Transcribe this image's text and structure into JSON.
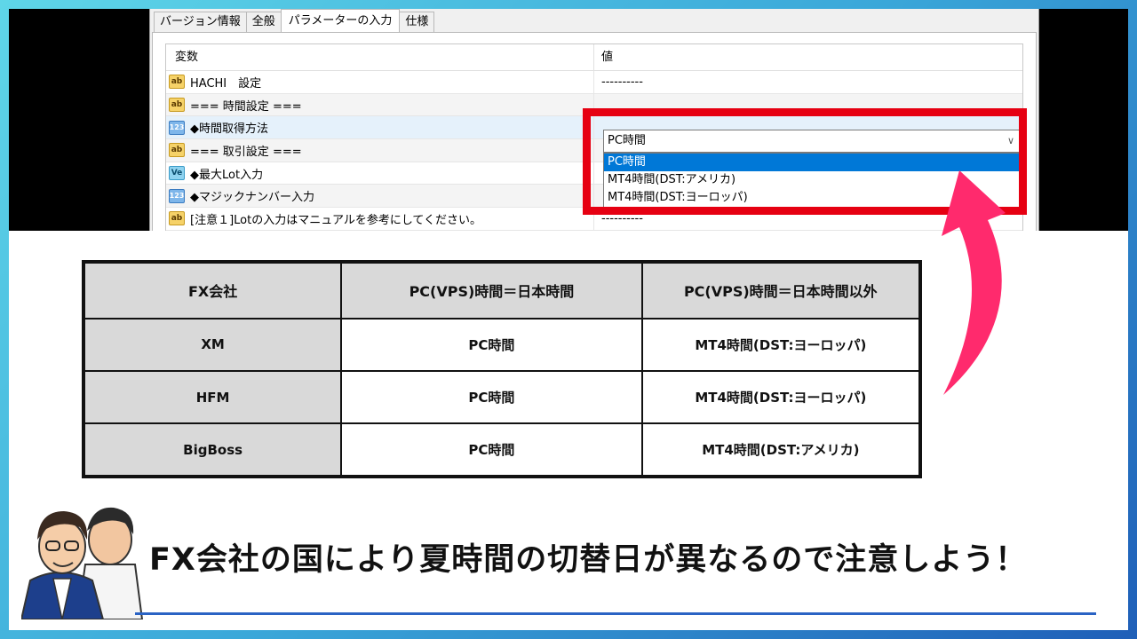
{
  "tabs": [
    "バージョン情報",
    "全般",
    "パラメーターの入力",
    "仕様"
  ],
  "grid": {
    "col_var": "変数",
    "col_val": "値",
    "rows": [
      {
        "icon": "ab",
        "name": "HACHI　設定",
        "value": "----------"
      },
      {
        "icon": "ab",
        "name": "=== 時間設定 ===",
        "value": ""
      },
      {
        "icon": "123",
        "name": "◆時間取得方法",
        "value": ""
      },
      {
        "icon": "ab",
        "name": "=== 取引設定 ===",
        "value": ""
      },
      {
        "icon": "ve",
        "name": "◆最大Lot入力",
        "value": ""
      },
      {
        "icon": "123",
        "name": "◆マジックナンバー入力",
        "value": ""
      },
      {
        "icon": "ab",
        "name": "[注意１]Lotの入力はマニュアルを参考にしてください。",
        "value": "----------"
      }
    ]
  },
  "dropdown": {
    "selected": "PC時間",
    "options": [
      "PC時間",
      "MT4時間(DST:アメリカ)",
      "MT4時間(DST:ヨーロッパ)"
    ]
  },
  "table": {
    "headers": [
      "FX会社",
      "PC(VPS)時間＝日本時間",
      "PC(VPS)時間＝日本時間以外"
    ],
    "rows": [
      [
        "XM",
        "PC時間",
        "MT4時間(DST:ヨーロッパ)"
      ],
      [
        "HFM",
        "PC時間",
        "MT4時間(DST:ヨーロッパ)"
      ],
      [
        "BigBoss",
        "PC時間",
        "MT4時間(DST:アメリカ)"
      ]
    ]
  },
  "caption": "FX会社の国により夏時間の切替日が異なるので注意しよう！",
  "colors": {
    "highlight": "#e60012",
    "arrow": "#ff2a6d",
    "accent": "#2a63c4"
  }
}
